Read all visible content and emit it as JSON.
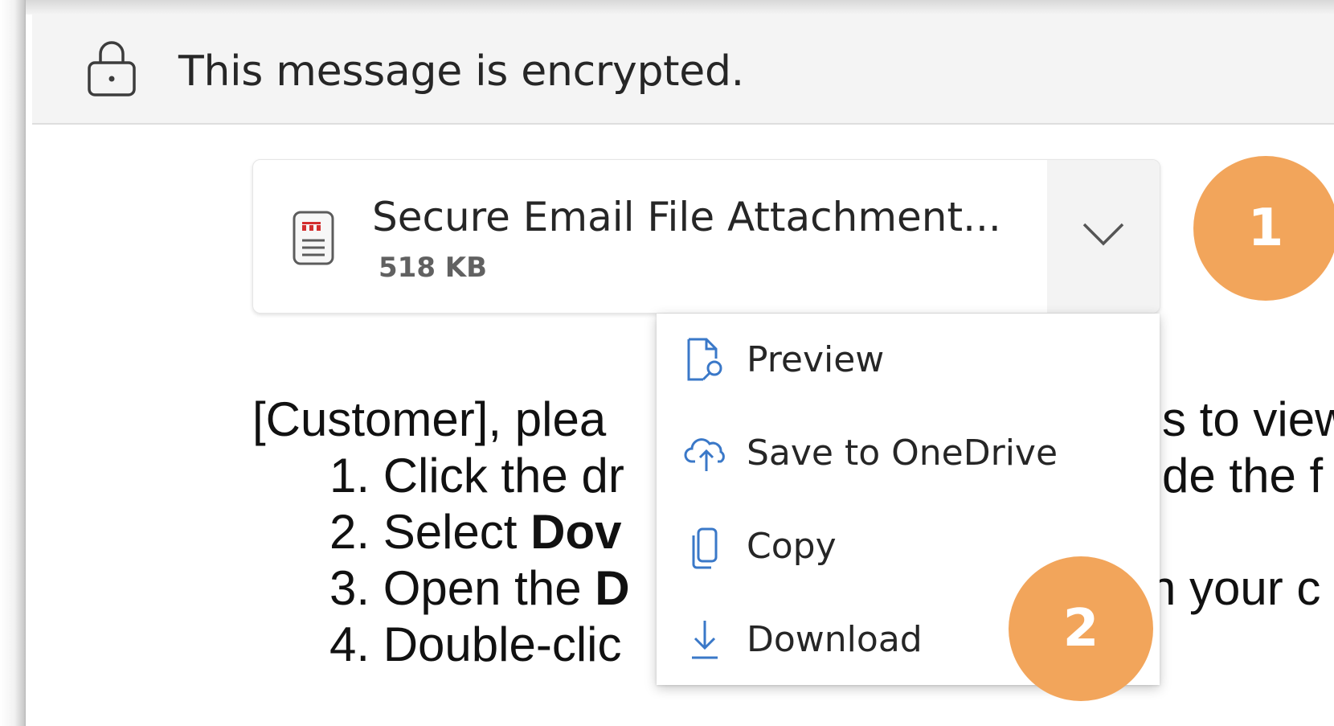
{
  "banner": {
    "text": "This message is encrypted.",
    "icon": "lock-icon"
  },
  "attachment": {
    "name": "Secure Email File Attachment...",
    "size": "518 KB",
    "icon": "file-icon",
    "dropdown_icon": "chevron-down-icon"
  },
  "callouts": {
    "step1": "1",
    "step2": "2"
  },
  "message": {
    "line0": "[Customer], plea",
    "line0_tail": "s to view",
    "line1": "1. Click the dr",
    "line1_tail": "de the f",
    "line2_pre": "2. Select ",
    "line2_bold": "Dov",
    "line3_pre": "3. Open the ",
    "line3_bold": "D",
    "line3_tail": "n your c",
    "line4": "4. Double-clic"
  },
  "menu": {
    "items": [
      {
        "label": "Preview",
        "icon": "preview-icon"
      },
      {
        "label": "Save to OneDrive",
        "icon": "cloud-upload-icon"
      },
      {
        "label": "Copy",
        "icon": "copy-icon"
      },
      {
        "label": "Download",
        "icon": "download-icon"
      }
    ]
  },
  "colors": {
    "badge": "#f2a55b",
    "menu_icon": "#3a78c8",
    "banner_bg": "#f4f4f4",
    "file_icon_red": "#d32f2f"
  }
}
